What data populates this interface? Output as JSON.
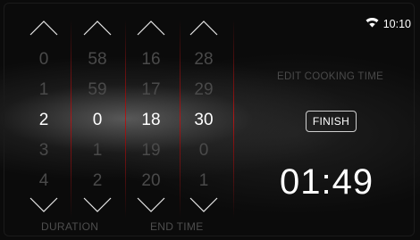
{
  "status": {
    "time": "10:10",
    "wifi_icon": "wifi-icon"
  },
  "pickers": [
    {
      "name": "duration-hours",
      "values": [
        "0",
        "1",
        "2",
        "3",
        "4"
      ]
    },
    {
      "name": "duration-minutes",
      "values": [
        "58",
        "59",
        "0",
        "1",
        "2"
      ]
    },
    {
      "name": "end-hours",
      "values": [
        "16",
        "17",
        "18",
        "19",
        "20"
      ]
    },
    {
      "name": "end-minutes",
      "values": [
        "28",
        "29",
        "30",
        "0",
        "1"
      ]
    }
  ],
  "labels": {
    "duration": "DURATION",
    "end_time": "END TIME"
  },
  "panel": {
    "title": "EDIT COOKING TIME",
    "finish_label": "FINISH",
    "remaining_time": "01:49"
  },
  "colors": {
    "accent_separator": "#b01818",
    "selected": "#ffffff",
    "dim": "#4a4a4a"
  }
}
